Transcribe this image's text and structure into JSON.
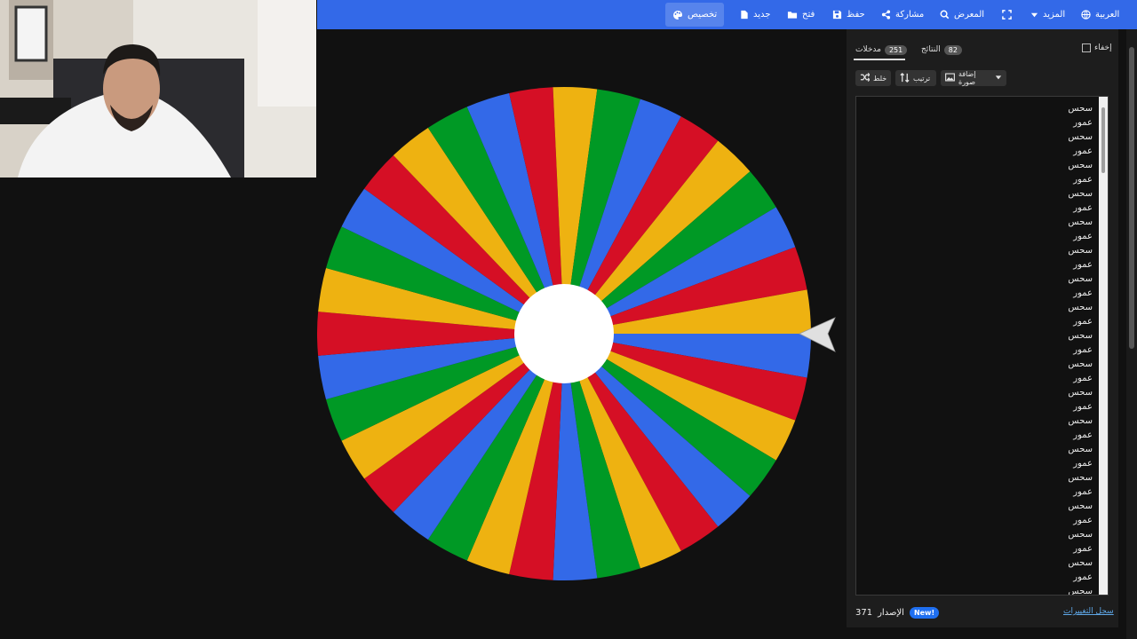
{
  "toolbar": {
    "items": [
      {
        "label": "العربية",
        "icon": "globe-icon"
      },
      {
        "label": "المزيد",
        "icon": "caret-down-icon"
      },
      {
        "label": "",
        "icon": "fullscreen-icon"
      },
      {
        "label": "المعرض",
        "icon": "search-icon"
      },
      {
        "label": "مشاركة",
        "icon": "share-icon"
      },
      {
        "label": "حفظ",
        "icon": "save-icon"
      },
      {
        "label": "فتح",
        "icon": "folder-icon"
      },
      {
        "label": "جديد",
        "icon": "new-file-icon"
      },
      {
        "label": "تخصيص",
        "icon": "palette-icon"
      }
    ],
    "accent_color": "#3369e8"
  },
  "wheel": {
    "slice_colors": [
      "#3369e8",
      "#d50f25",
      "#eeb211",
      "#009925"
    ],
    "center_color": "#ffffff",
    "pointer_color": "#e0e0e0"
  },
  "panel": {
    "hide_label": "إخفاء",
    "tabs": [
      {
        "label": "النتائج",
        "count": "82"
      },
      {
        "label": "مدخلات",
        "count": "251"
      }
    ],
    "tools": {
      "add_image": "إضافة صورة",
      "sort": "ترتيب",
      "shuffle": "خلط"
    },
    "entries": [
      "سحس",
      "عمور",
      "سحس",
      "عمور",
      "سحس",
      "عمور",
      "سحس",
      "عمور",
      "سحس",
      "عمور",
      "سحس",
      "عمور",
      "سحس",
      "عمور",
      "سحس",
      "عمور",
      "سحس",
      "عمور",
      "سحس",
      "عمور",
      "سحس",
      "عمور",
      "سحس",
      "عمور",
      "سحس",
      "عمور",
      "سحس",
      "عمور",
      "سحس",
      "عمور",
      "سحس",
      "عمور",
      "سحس",
      "عمور",
      "سحس"
    ],
    "footer": {
      "version_label": "الإصدار",
      "version": "371",
      "new_badge": "New!",
      "changelog": "سجل التغييرات"
    }
  }
}
